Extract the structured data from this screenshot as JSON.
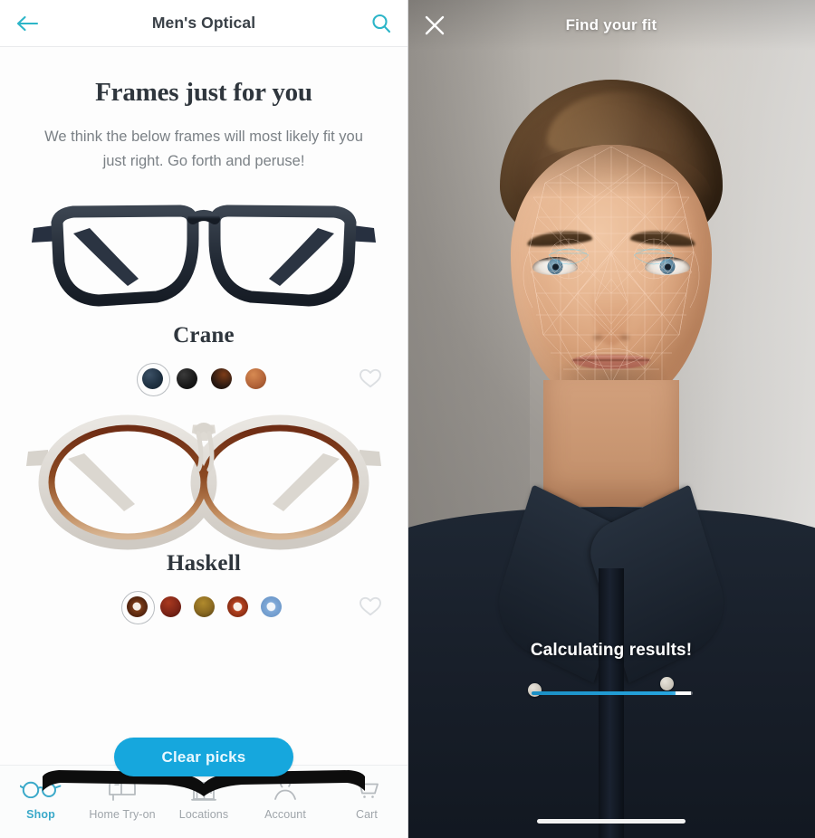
{
  "left_panel": {
    "header": {
      "title": "Men's Optical",
      "back_icon": "arrow-left-icon",
      "search_icon": "search-icon",
      "accent_color": "#2cb5c8"
    },
    "promo": {
      "title": "Frames just for you",
      "subtitle": "We think the below frames will most likely fit you just right. Go forth and peruse!"
    },
    "products": [
      {
        "name": "Crane",
        "image_alt": "dark navy rectangular eyeglass frames",
        "favorite_icon": "heart-outline-icon",
        "swatches": [
          {
            "name": "navy-blue",
            "color": "#203243",
            "selected": true
          },
          {
            "name": "black",
            "color": "#181818",
            "selected": false
          },
          {
            "name": "dark-tortoise",
            "color": "#2b1a12",
            "selected": false
          },
          {
            "name": "copper-tortoise",
            "color": "#b5663a",
            "selected": false
          }
        ]
      },
      {
        "name": "Haskell",
        "image_alt": "round tortoise and crystal eyeglass frames",
        "favorite_icon": "heart-outline-icon",
        "swatches": [
          {
            "name": "crystal-tortoise",
            "color": "#7a3c18",
            "inner": "#f6efe6",
            "selected": true
          },
          {
            "name": "dark-red-tortoise",
            "color": "#7e2517",
            "inner": "",
            "selected": false
          },
          {
            "name": "olive-amber",
            "color": "#8c6b21",
            "inner": "",
            "selected": false
          },
          {
            "name": "red-crystal",
            "color": "#b4421f",
            "inner": "#f8f1e9",
            "selected": false
          },
          {
            "name": "blue-crystal",
            "color": "#7fa9d8",
            "inner": "#f2f6fb",
            "selected": false
          }
        ]
      },
      {
        "name": "",
        "image_alt": "black frame top partially visible",
        "favorite_icon": "",
        "swatches": []
      }
    ],
    "clear_picks_button": "Clear picks",
    "clear_picks_color": "#16a7dd",
    "tabs": [
      {
        "label": "Shop",
        "icon": "glasses-icon",
        "active": true
      },
      {
        "label": "Home Try-on",
        "icon": "mailbox-icon",
        "active": false
      },
      {
        "label": "Locations",
        "icon": "storefront-icon",
        "active": false
      },
      {
        "label": "Account",
        "icon": "person-icon",
        "active": false
      },
      {
        "label": "Cart",
        "icon": "shopping-cart-icon",
        "active": false
      }
    ]
  },
  "right_panel": {
    "header": {
      "title": "Find your fit",
      "close_icon": "close-icon"
    },
    "status_text": "Calculating results!",
    "progress": {
      "percent": 90,
      "fill_color": "#27a6e0",
      "head_color": "#ffffff"
    },
    "overlay": "face-tracking-mesh",
    "home_indicator": "home-indicator-bar"
  }
}
